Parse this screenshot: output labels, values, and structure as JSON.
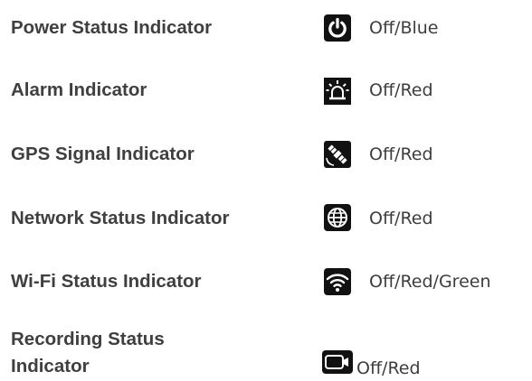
{
  "indicators": [
    {
      "label": "Power Status Indicator",
      "value": "Off/Blue",
      "icon": "power-icon"
    },
    {
      "label": "Alarm Indicator",
      "value": "Off/Red",
      "icon": "alarm-light-icon"
    },
    {
      "label": "GPS Signal Indicator",
      "value": "Off/Red",
      "icon": "satellite-icon"
    },
    {
      "label": "Network Status Indicator",
      "value": "Off/Red",
      "icon": "globe-icon"
    },
    {
      "label": "Wi-Fi Status Indicator",
      "value": "Off/Red/Green",
      "icon": "wifi-icon"
    },
    {
      "label_line1": "Recording Status",
      "label_line2": "Indicator",
      "value": "Off/Red",
      "icon": "camera-icon"
    }
  ]
}
